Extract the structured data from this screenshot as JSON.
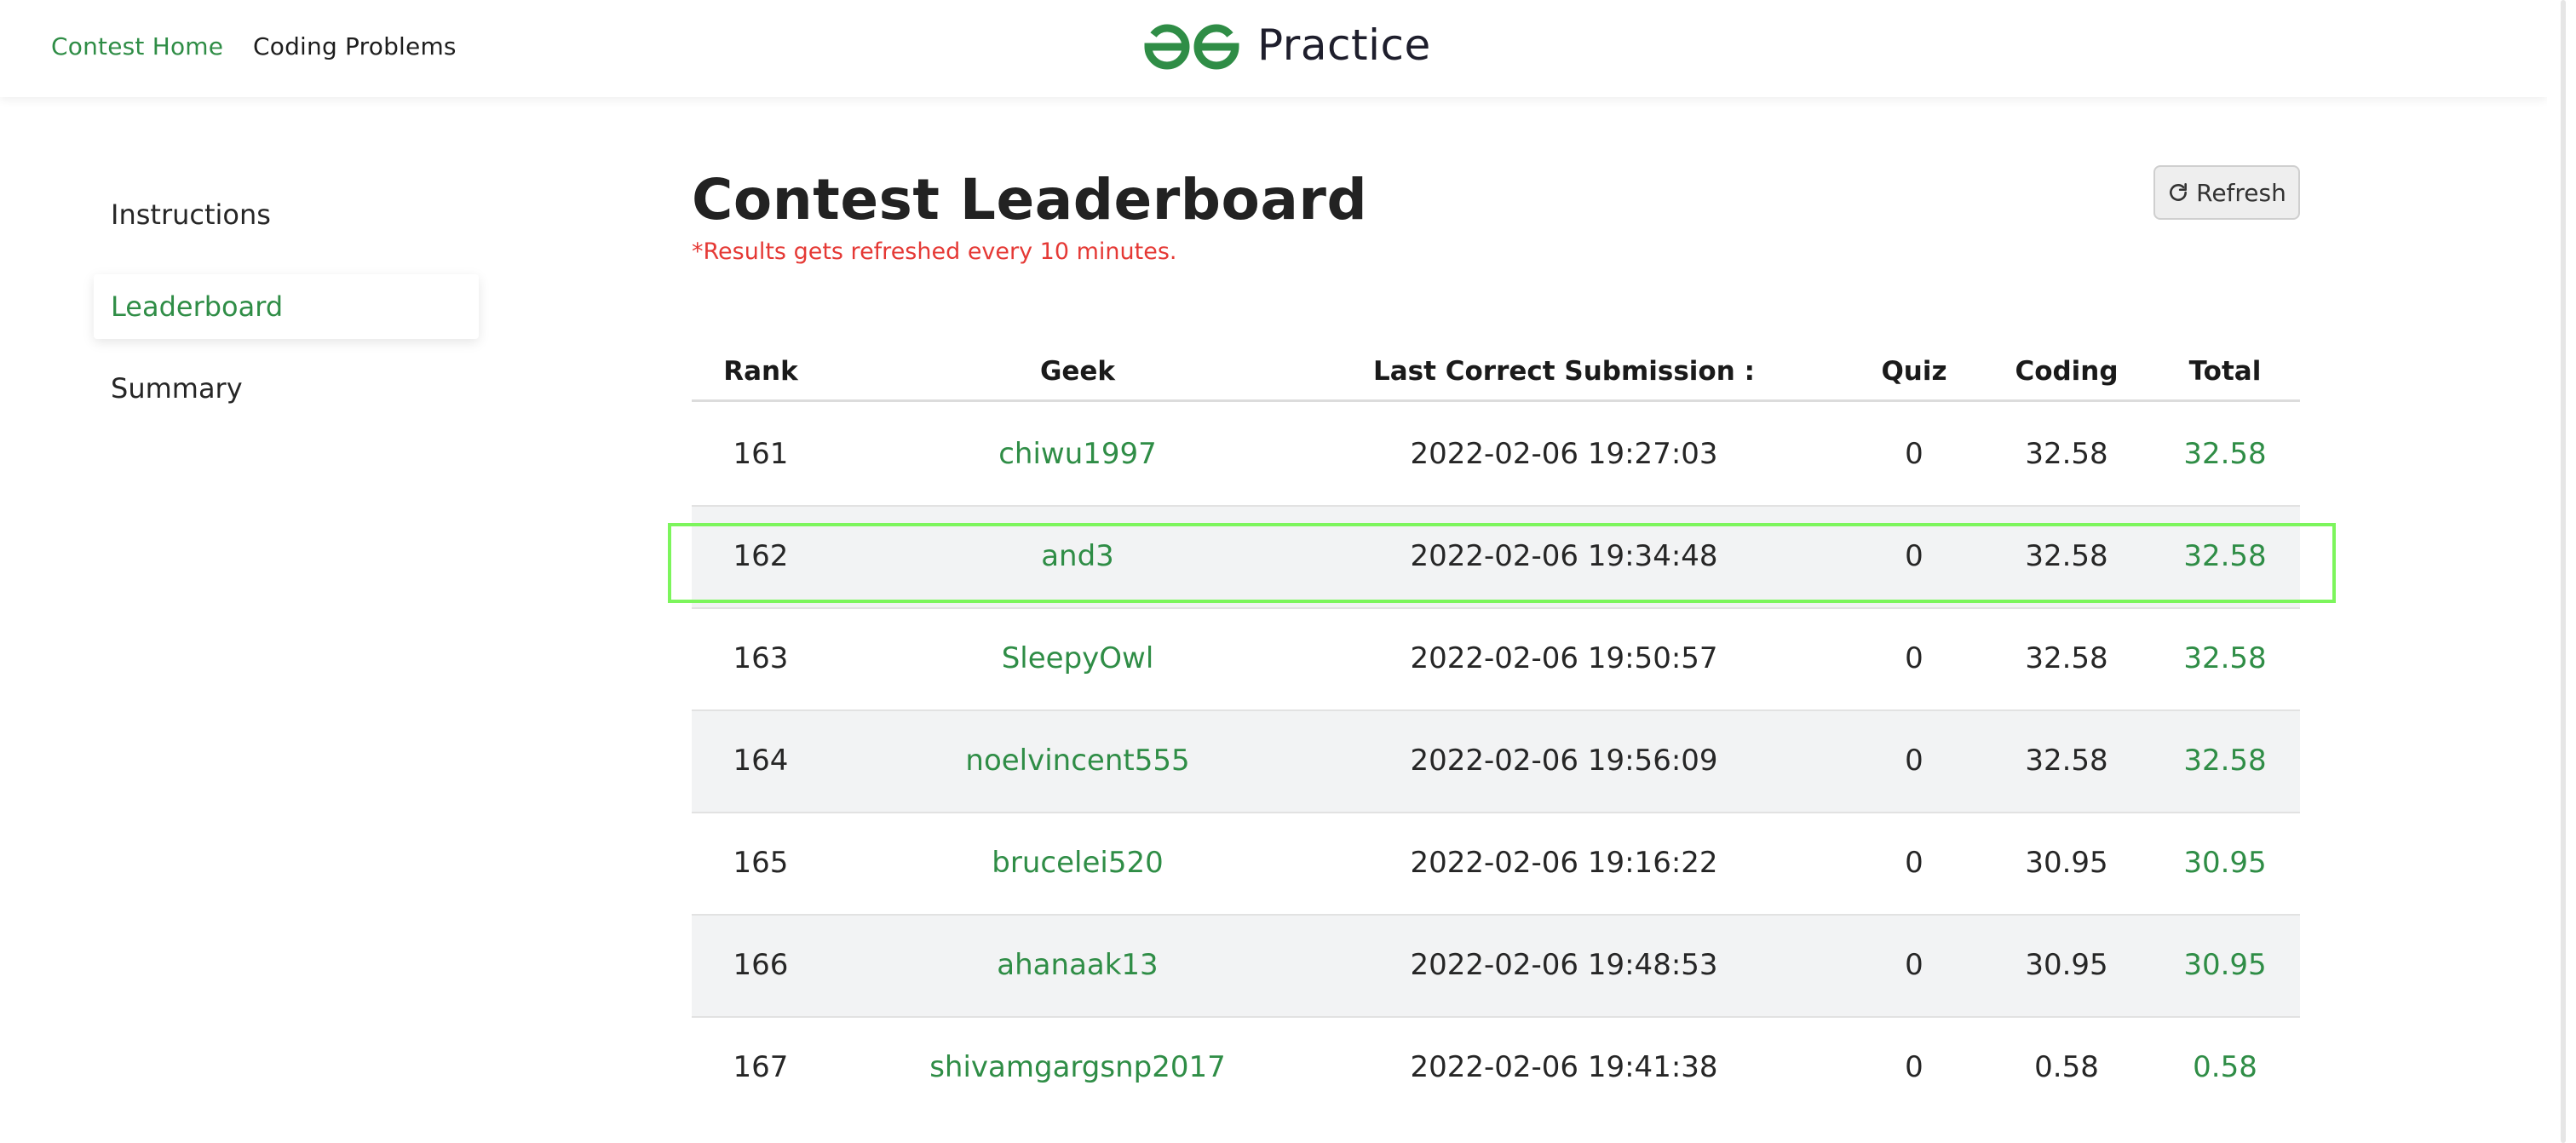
{
  "topnav": {
    "contest_home": "Contest Home",
    "coding_problems": "Coding Problems",
    "logo_text": "Practice"
  },
  "sidebar": {
    "items": [
      {
        "label": "Instructions"
      },
      {
        "label": "Leaderboard"
      },
      {
        "label": "Summary"
      }
    ]
  },
  "main": {
    "title": "Contest Leaderboard",
    "note": "*Results gets refreshed every 10 minutes.",
    "refresh_label": "Refresh"
  },
  "table": {
    "headers": [
      "Rank",
      "Geek",
      "Last Correct Submission :",
      "Quiz",
      "Coding",
      "Total"
    ],
    "rows": [
      {
        "rank": "161",
        "geek": "chiwu1997",
        "time": "2022-02-06 19:27:03",
        "quiz": "0",
        "coding": "32.58",
        "total": "32.58"
      },
      {
        "rank": "162",
        "geek": "and3",
        "time": "2022-02-06 19:34:48",
        "quiz": "0",
        "coding": "32.58",
        "total": "32.58"
      },
      {
        "rank": "163",
        "geek": "SleepyOwl",
        "time": "2022-02-06 19:50:57",
        "quiz": "0",
        "coding": "32.58",
        "total": "32.58"
      },
      {
        "rank": "164",
        "geek": "noelvincent555",
        "time": "2022-02-06 19:56:09",
        "quiz": "0",
        "coding": "32.58",
        "total": "32.58"
      },
      {
        "rank": "165",
        "geek": "brucelei520",
        "time": "2022-02-06 19:16:22",
        "quiz": "0",
        "coding": "30.95",
        "total": "30.95"
      },
      {
        "rank": "166",
        "geek": "ahanaak13",
        "time": "2022-02-06 19:48:53",
        "quiz": "0",
        "coding": "30.95",
        "total": "30.95"
      },
      {
        "rank": "167",
        "geek": "shivamgargsnp2017",
        "time": "2022-02-06 19:41:38",
        "quiz": "0",
        "coding": "0.58",
        "total": "0.58"
      }
    ]
  },
  "colors": {
    "brand_green": "#2f8d46",
    "note_red": "#e53935",
    "highlight": "#7cf55c"
  },
  "icons": {
    "logo": "gfg-logo-icon",
    "refresh": "refresh-icon"
  }
}
